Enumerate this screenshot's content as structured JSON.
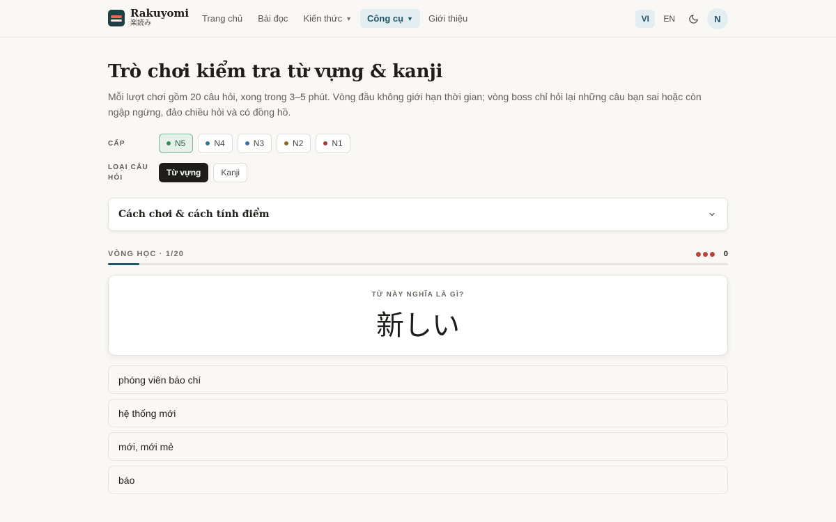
{
  "header": {
    "brand_name": "Rakuyomi",
    "brand_sub": "楽読み",
    "nav": [
      {
        "label": "Trang chủ"
      },
      {
        "label": "Bài đọc"
      },
      {
        "label": "Kiến thức"
      },
      {
        "label": "Công cụ"
      },
      {
        "label": "Giới thiệu"
      }
    ],
    "lang_vi": "VI",
    "lang_en": "EN",
    "avatar_initial": "N",
    "accent_color": "#1f5566"
  },
  "page": {
    "title": "Trò chơi kiểm tra từ vựng & kanji",
    "description": "Mỗi lượt chơi gồm 20 câu hỏi, xong trong 3–5 phút. Vòng đầu không giới hạn thời gian; vòng boss chỉ hỏi lại những câu bạn sai hoặc còn ngập ngừng, đảo chiều hỏi và có đồng hồ."
  },
  "level": {
    "label": "CẤP",
    "options": [
      {
        "label": "N5",
        "color": "#3f8a5c",
        "selected": true
      },
      {
        "label": "N4",
        "color": "#2f7a8a",
        "selected": false
      },
      {
        "label": "N3",
        "color": "#3d6fa8",
        "selected": false
      },
      {
        "label": "N2",
        "color": "#8a6a2a",
        "selected": false
      },
      {
        "label": "N1",
        "color": "#a83a3a",
        "selected": false
      }
    ]
  },
  "question_type": {
    "label": "LOẠI CÂU HỎI",
    "options": [
      {
        "label": "Từ vựng",
        "selected": true
      },
      {
        "label": "Kanji",
        "selected": false
      }
    ]
  },
  "howto": {
    "title": "Cách chơi & cách tính điểm"
  },
  "round": {
    "label": "VÒNG HỌC · 1/20",
    "progress": 0.05,
    "lives": 3,
    "score": "0"
  },
  "question": {
    "prompt": "TỪ NÀY NGHĨA LÀ GÌ?",
    "word": "新しい"
  },
  "answers": [
    {
      "label": "phóng viên báo chí"
    },
    {
      "label": "hệ thống mới"
    },
    {
      "label": "mới, mới mẻ"
    },
    {
      "label": "báo"
    }
  ]
}
